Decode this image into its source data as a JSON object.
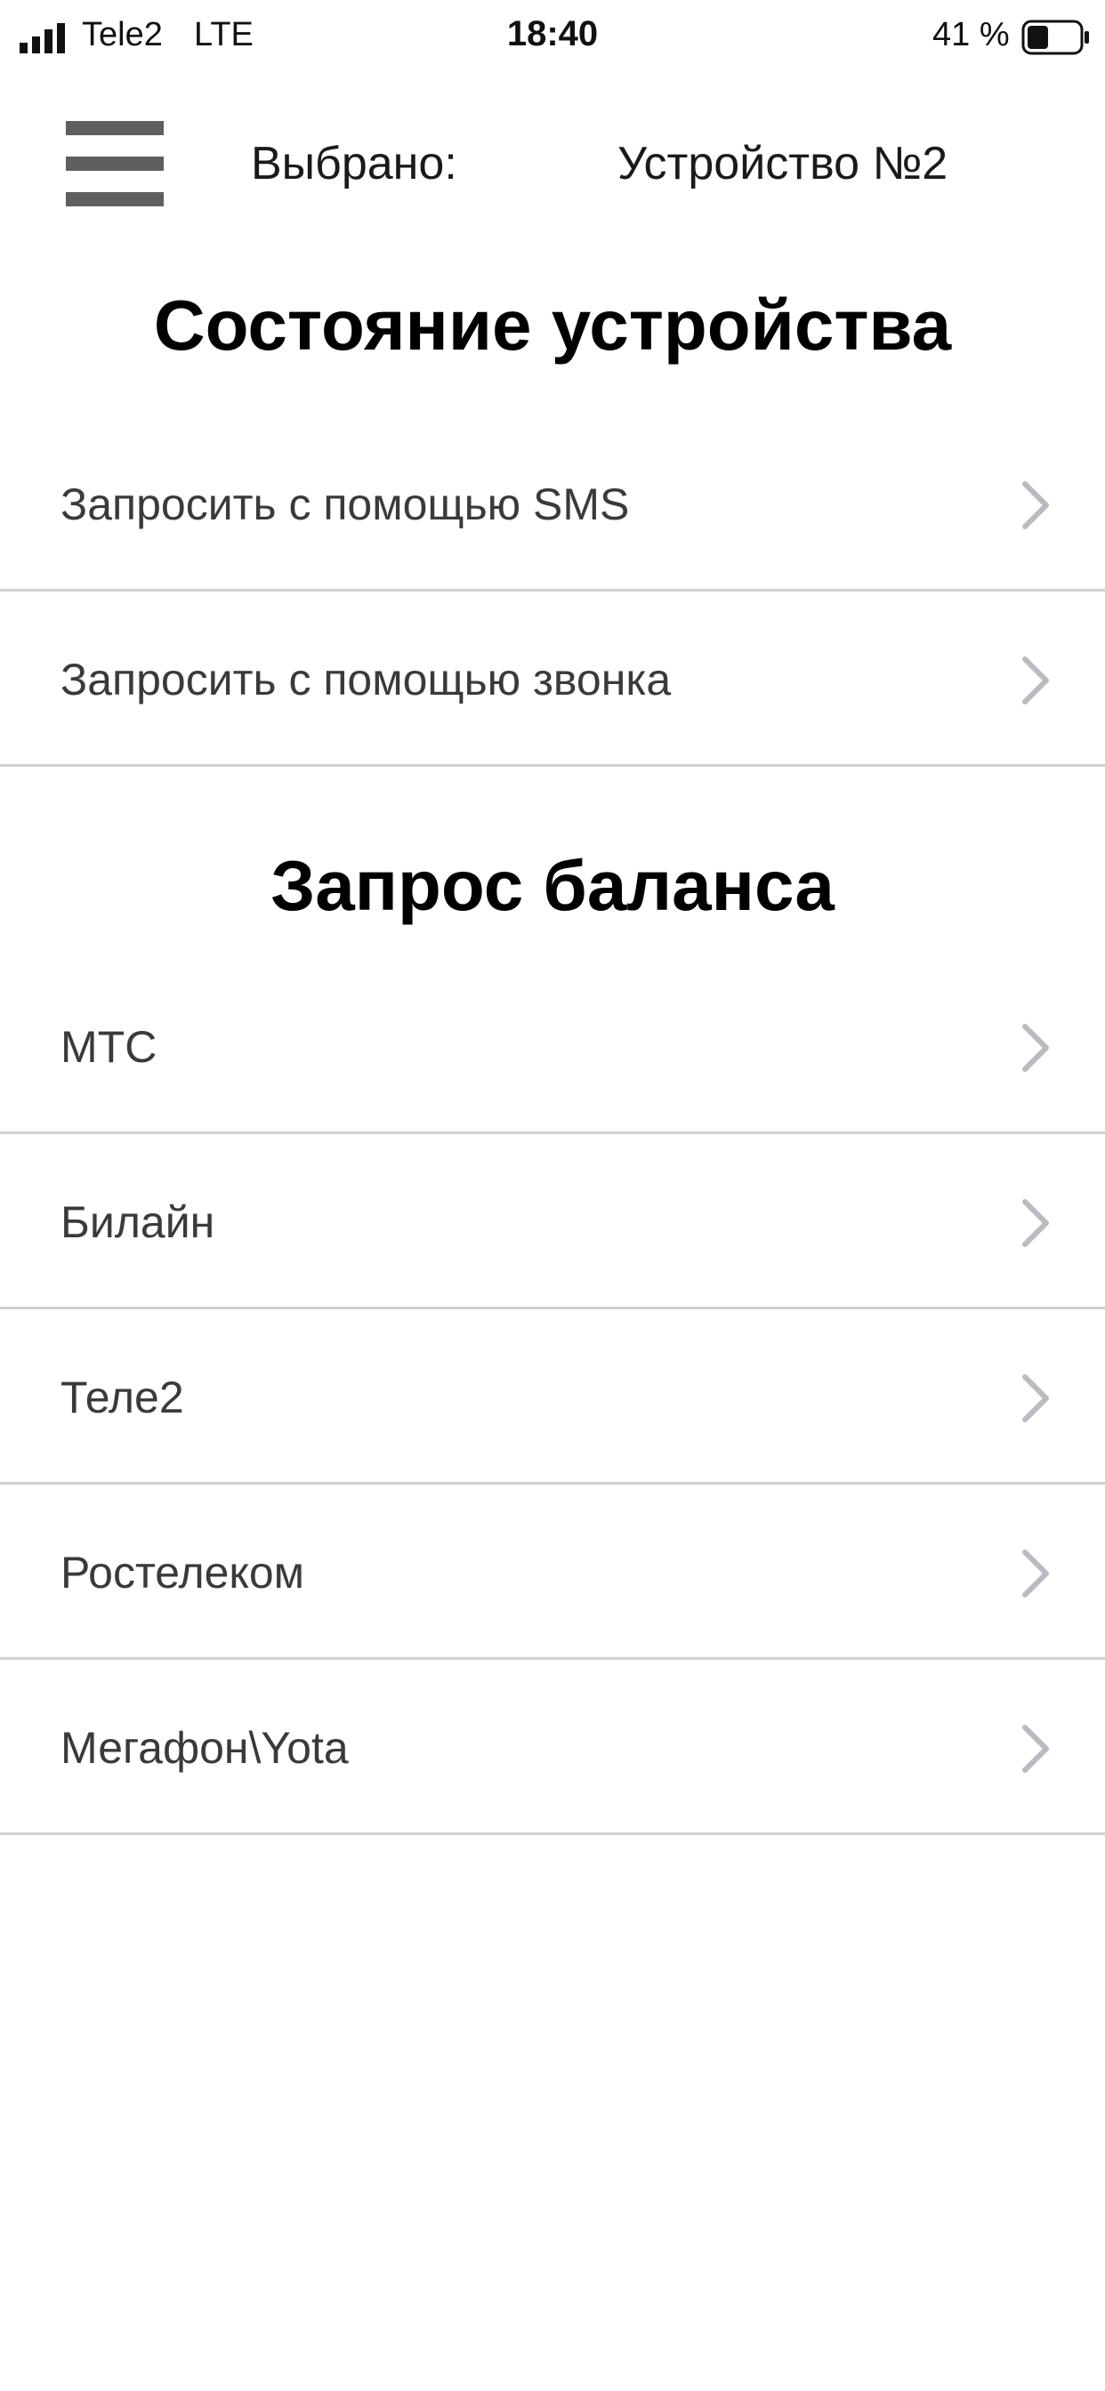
{
  "status_bar": {
    "carrier": "Tele2",
    "network": "LTE",
    "time": "18:40",
    "battery_percent": "41 %",
    "battery_level": 0.41,
    "signal_icon": "signal-bars-icon",
    "battery_icon": "battery-icon"
  },
  "header": {
    "menu_icon": "hamburger-menu-icon",
    "selected_label": "Выбрано:",
    "selected_device": "Устройство №2"
  },
  "device_state": {
    "title": "Состояние устройства",
    "items": [
      {
        "label": "Запросить с помощью SMS"
      },
      {
        "label": "Запросить с помощью звонка"
      }
    ]
  },
  "balance": {
    "title": "Запрос баланса",
    "items": [
      {
        "label": "МТС"
      },
      {
        "label": "Билайн"
      },
      {
        "label": "Теле2"
      },
      {
        "label": "Ростелеком"
      },
      {
        "label": "Мегафон\\Yota"
      }
    ]
  },
  "colors": {
    "divider": "#cfd1d4",
    "chevron": "#b8bcc2",
    "menu_icon": "#5f5f5f",
    "item_text": "#3a3a3a"
  }
}
